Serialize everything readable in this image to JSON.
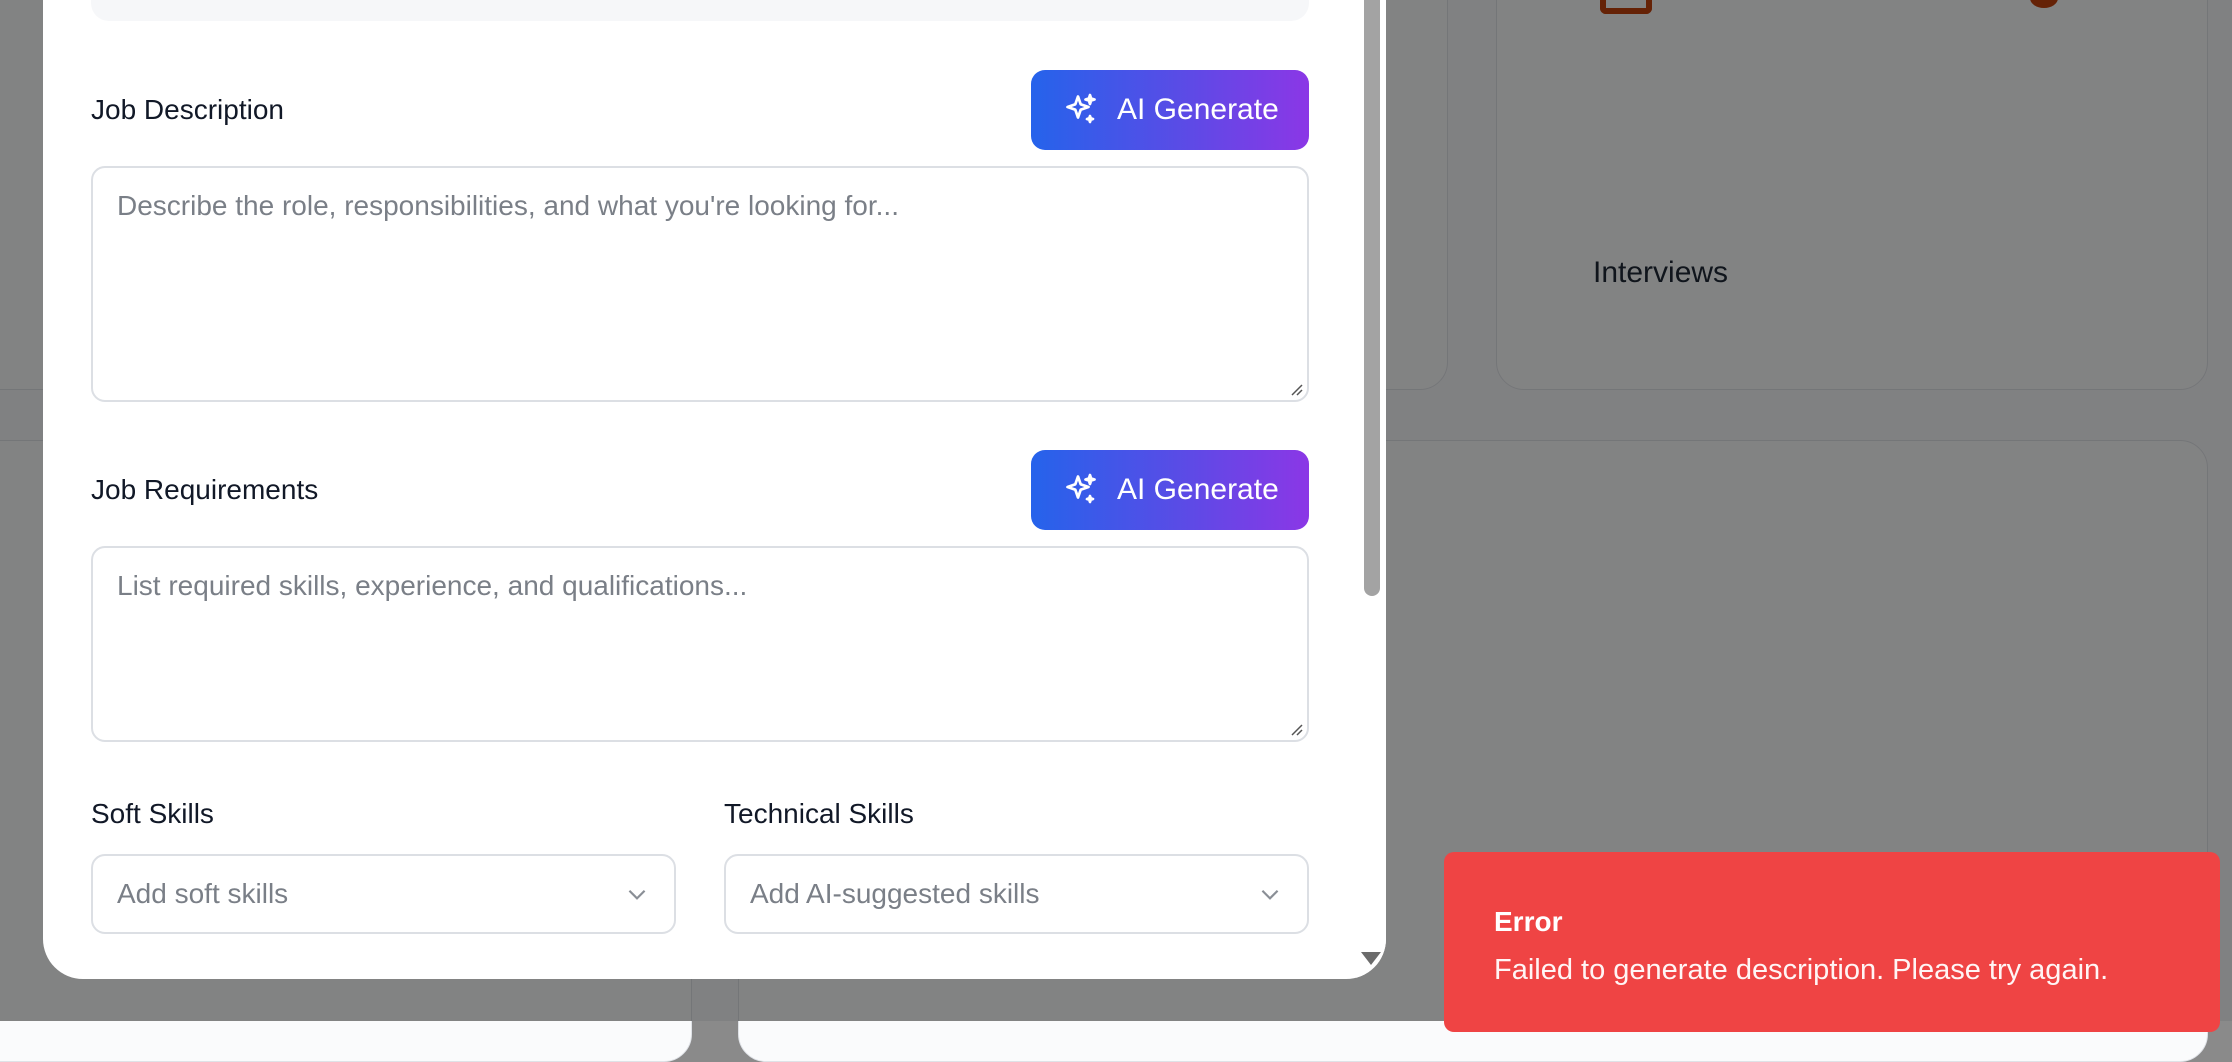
{
  "background": {
    "card_label": "Interviews"
  },
  "modal": {
    "job_description": {
      "label": "Job Description",
      "ai_button": "AI Generate",
      "placeholder": "Describe the role, responsibilities, and what you're looking for..."
    },
    "job_requirements": {
      "label": "Job Requirements",
      "ai_button": "AI Generate",
      "placeholder": "List required skills, experience, and qualifications..."
    },
    "soft_skills": {
      "label": "Soft Skills",
      "placeholder": "Add soft skills"
    },
    "technical_skills": {
      "label": "Technical Skills",
      "placeholder": "Add AI-suggested skills"
    }
  },
  "toast": {
    "title": "Error",
    "message": "Failed to generate description. Please try again."
  },
  "colors": {
    "ai_gradient_start": "#2563eb",
    "ai_gradient_end": "#8b37e6",
    "toast_error": "#ef4444",
    "accent_orange": "#c2410c"
  },
  "icons": {
    "ai_button": "sparkles-icon",
    "select": "chevron-down-icon"
  }
}
